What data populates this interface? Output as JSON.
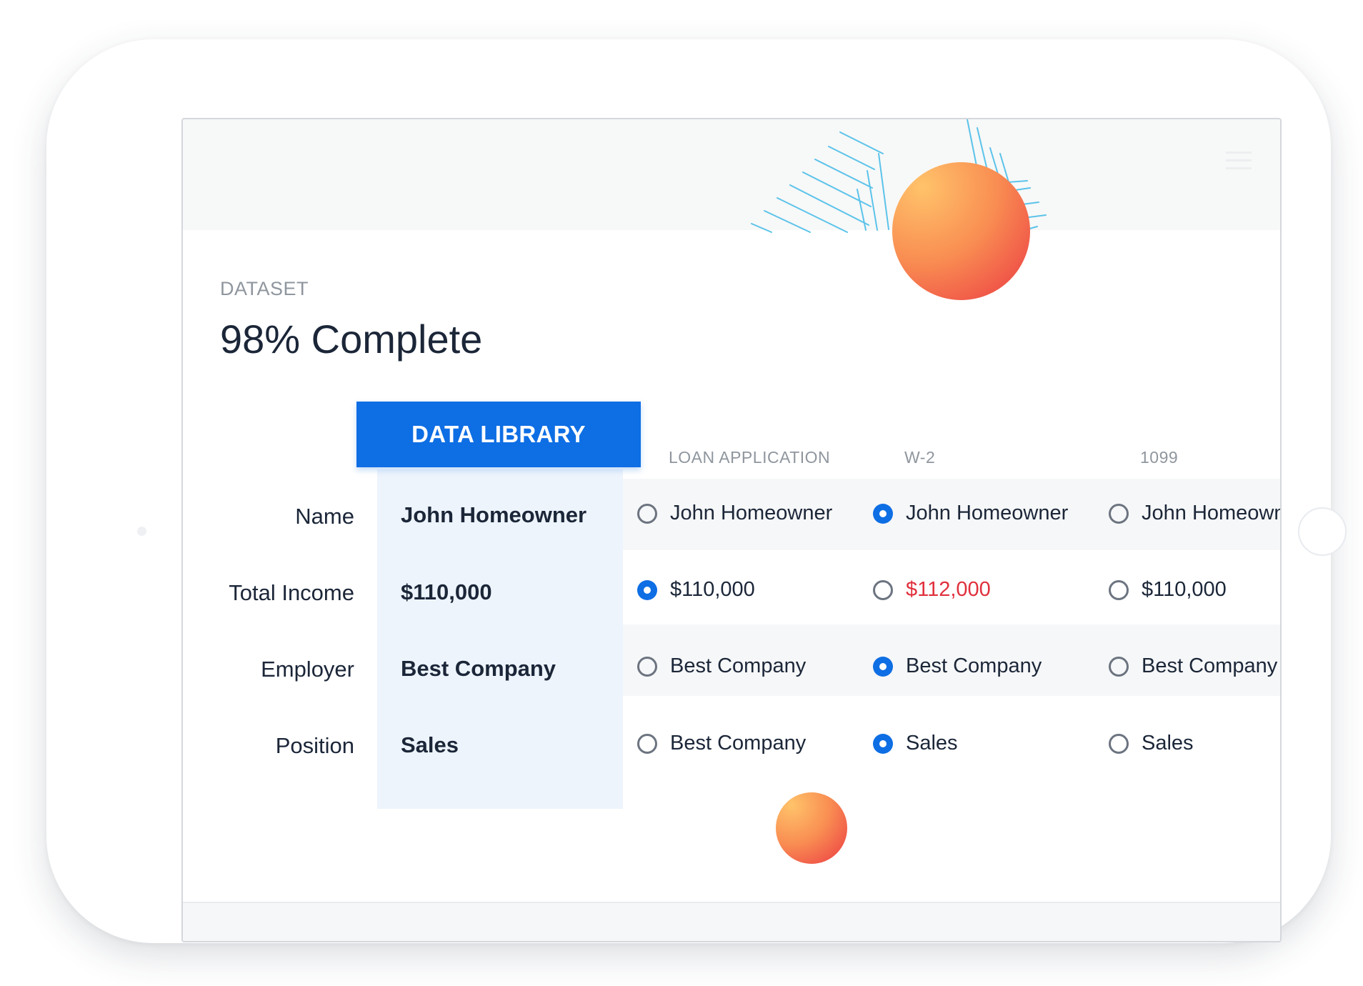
{
  "dataset_label": "DATASET",
  "completion_title": "98% Complete",
  "data_library_tab": "DATA LIBRARY",
  "columns": [
    "LOAN APPLICATION",
    "W-2",
    "1099"
  ],
  "rows": [
    {
      "label": "Name",
      "library_value": "John Homeowner",
      "options": [
        {
          "text": "John Homeowner",
          "selected": false
        },
        {
          "text": "John Homeowner",
          "selected": true
        },
        {
          "text": "John Homeowner",
          "selected": false
        }
      ]
    },
    {
      "label": "Total Income",
      "library_value": "$110,000",
      "options": [
        {
          "text": "$110,000",
          "selected": true
        },
        {
          "text": "$112,000",
          "selected": false,
          "status": "mismatch"
        },
        {
          "text": "$110,000",
          "selected": false
        }
      ]
    },
    {
      "label": "Employer",
      "library_value": "Best Company",
      "options": [
        {
          "text": "Best Company",
          "selected": false
        },
        {
          "text": "Best Company",
          "selected": true
        },
        {
          "text": "Best Company",
          "selected": false
        }
      ]
    },
    {
      "label": "Position",
      "library_value": "Sales",
      "options": [
        {
          "text": "Best Company",
          "selected": false
        },
        {
          "text": "Sales",
          "selected": true
        },
        {
          "text": "Sales",
          "selected": false
        }
      ]
    }
  ],
  "icons": [
    "menu-icon",
    "radio-unselected-icon",
    "radio-selected-icon"
  ],
  "colors": {
    "accent": "#0e6ee4",
    "mismatch": "#e0303c",
    "text": "#1b2638",
    "muted": "#8f969e",
    "library_column": "#edf4fc",
    "pattern": "#5bc3ea",
    "sphere_gradient": [
      "#ffc36a",
      "#f98d52",
      "#eb3943"
    ]
  }
}
